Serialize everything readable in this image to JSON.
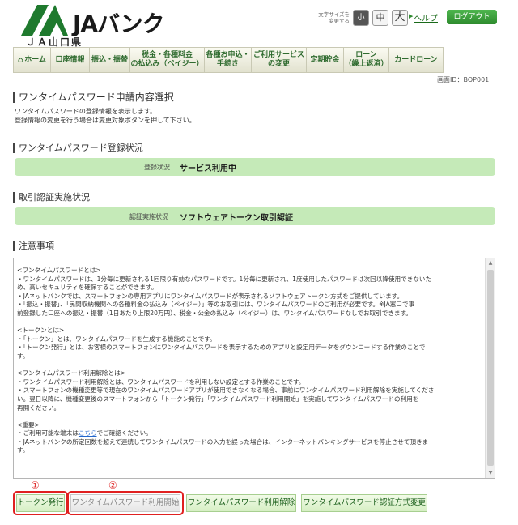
{
  "header": {
    "logo_text": "JAバンク",
    "logo_sub": "ＪＡ山口県",
    "fontsize_label_1": "文字サイズを",
    "fontsize_label_2": "変更する",
    "fontsize_small": "小",
    "fontsize_medium": "中",
    "fontsize_large": "大",
    "help": "ヘルプ",
    "logout": "ログアウト"
  },
  "nav": {
    "items": [
      {
        "label": "ホーム"
      },
      {
        "label": "口座情報"
      },
      {
        "label": "振込・振替"
      },
      {
        "line1": "税金・各種料金",
        "line2": "の払込み（ペイジー）"
      },
      {
        "line1": "各種お申込・",
        "line2": "手続き"
      },
      {
        "line1": "ご利用サービス",
        "line2": "の変更"
      },
      {
        "label": "定期貯金"
      },
      {
        "line1": "ローン",
        "line2": "（繰上返済）"
      },
      {
        "label": "カードローン"
      }
    ]
  },
  "screen_id": "画面ID：BOP001",
  "page": {
    "title": "ワンタイムパスワード申請内容選択",
    "intro_1": "ワンタイムパスワードの登録情報を表示します。",
    "intro_2": "登録情報の変更を行う場合は変更対象ボタンを押して下さい。"
  },
  "registration": {
    "heading": "ワンタイムパスワード登録状況",
    "label": "登録状況",
    "value": "サービス利用中"
  },
  "auth": {
    "heading": "取引認証実施状況",
    "label": "認証実施状況",
    "value": "ソフトウェアトークン取引認証"
  },
  "notes": {
    "heading": "注意事項",
    "l1": "<ワンタイムパスワードとは>",
    "l2": "・ワンタイムパスワードは、1分毎に更新される1回限り有効なパスワードです。1分毎に更新され、1度使用したパスワードは次回以降使用できないため、高いセキュリティを確保することができます。",
    "l2b": "め、高いセキュリティを確保することができます。",
    "l3": "・JAネットバンクでは、スマートフォンの専用アプリにワンタイムパスワードが表示されるソフトウェアトークン方式をご提供しています。",
    "l4": "・「振込・振替」、「民間収納機関への各種料金の払込み（ペイジー）」等のお取引には、ワンタイムパスワードのご利用が必要です。※JA窓口で事",
    "l4b": "前登録した口座への振込・振替（1日あたり上限20万円）、税金・公金の払込み（ペイジー）は、ワンタイムパスワードなしでお取引できます。",
    "l5": "<トークンとは>",
    "l6": "・「トークン」とは、ワンタイムパスワードを生成する機能のことです。",
    "l7": "・「トークン発行」とは、お客様のスマートフォンにワンタイムパスワードを表示するためのアプリと設定用データをダウンロードする作業のことです。",
    "l7b": "す。",
    "l8": "<ワンタイムパスワード利用解除とは>",
    "l9": "・ワンタイムパスワード利用解除とは、ワンタイムパスワードを利用しない設定とする作業のことです。",
    "l10": "・スマートフォンの機種変更等で現在のワンタイムパスワードアプリが使用できなくなる場合、事前にワンタイムパスワード利用解除を実施してくださ",
    "l10b": "い。翌日以降に、機種変更後のスマートフォンから「トークン発行」「ワンタイムパスワード利用開始」を実施してワンタイムパスワードの利用を",
    "l10c": "再開ください。",
    "l11": "<重要>",
    "l12a": "・ご利用可能な端末は",
    "l12link": "こちら",
    "l12b": "でご確認ください。",
    "l13": "・JAネットバンクの所定回数を超えて連続してワンタイムパスワードの入力を誤った場合は、インターネットバンキングサービスを停止させて頂きます。",
    "l13b": "す。"
  },
  "markers": {
    "m1": "①",
    "m2": "②"
  },
  "buttons": {
    "issue_token": "トークン発行",
    "start_use": "ワンタイムパスワード利用開始",
    "cancel_use": "ワンタイムパスワード利用解除",
    "change_auth": "ワンタイムパスワード認証方式変更"
  },
  "colors": {
    "accent_green": "#2e8b2e",
    "status_band": "#c5eab8",
    "highlight_red": "#e02020"
  }
}
